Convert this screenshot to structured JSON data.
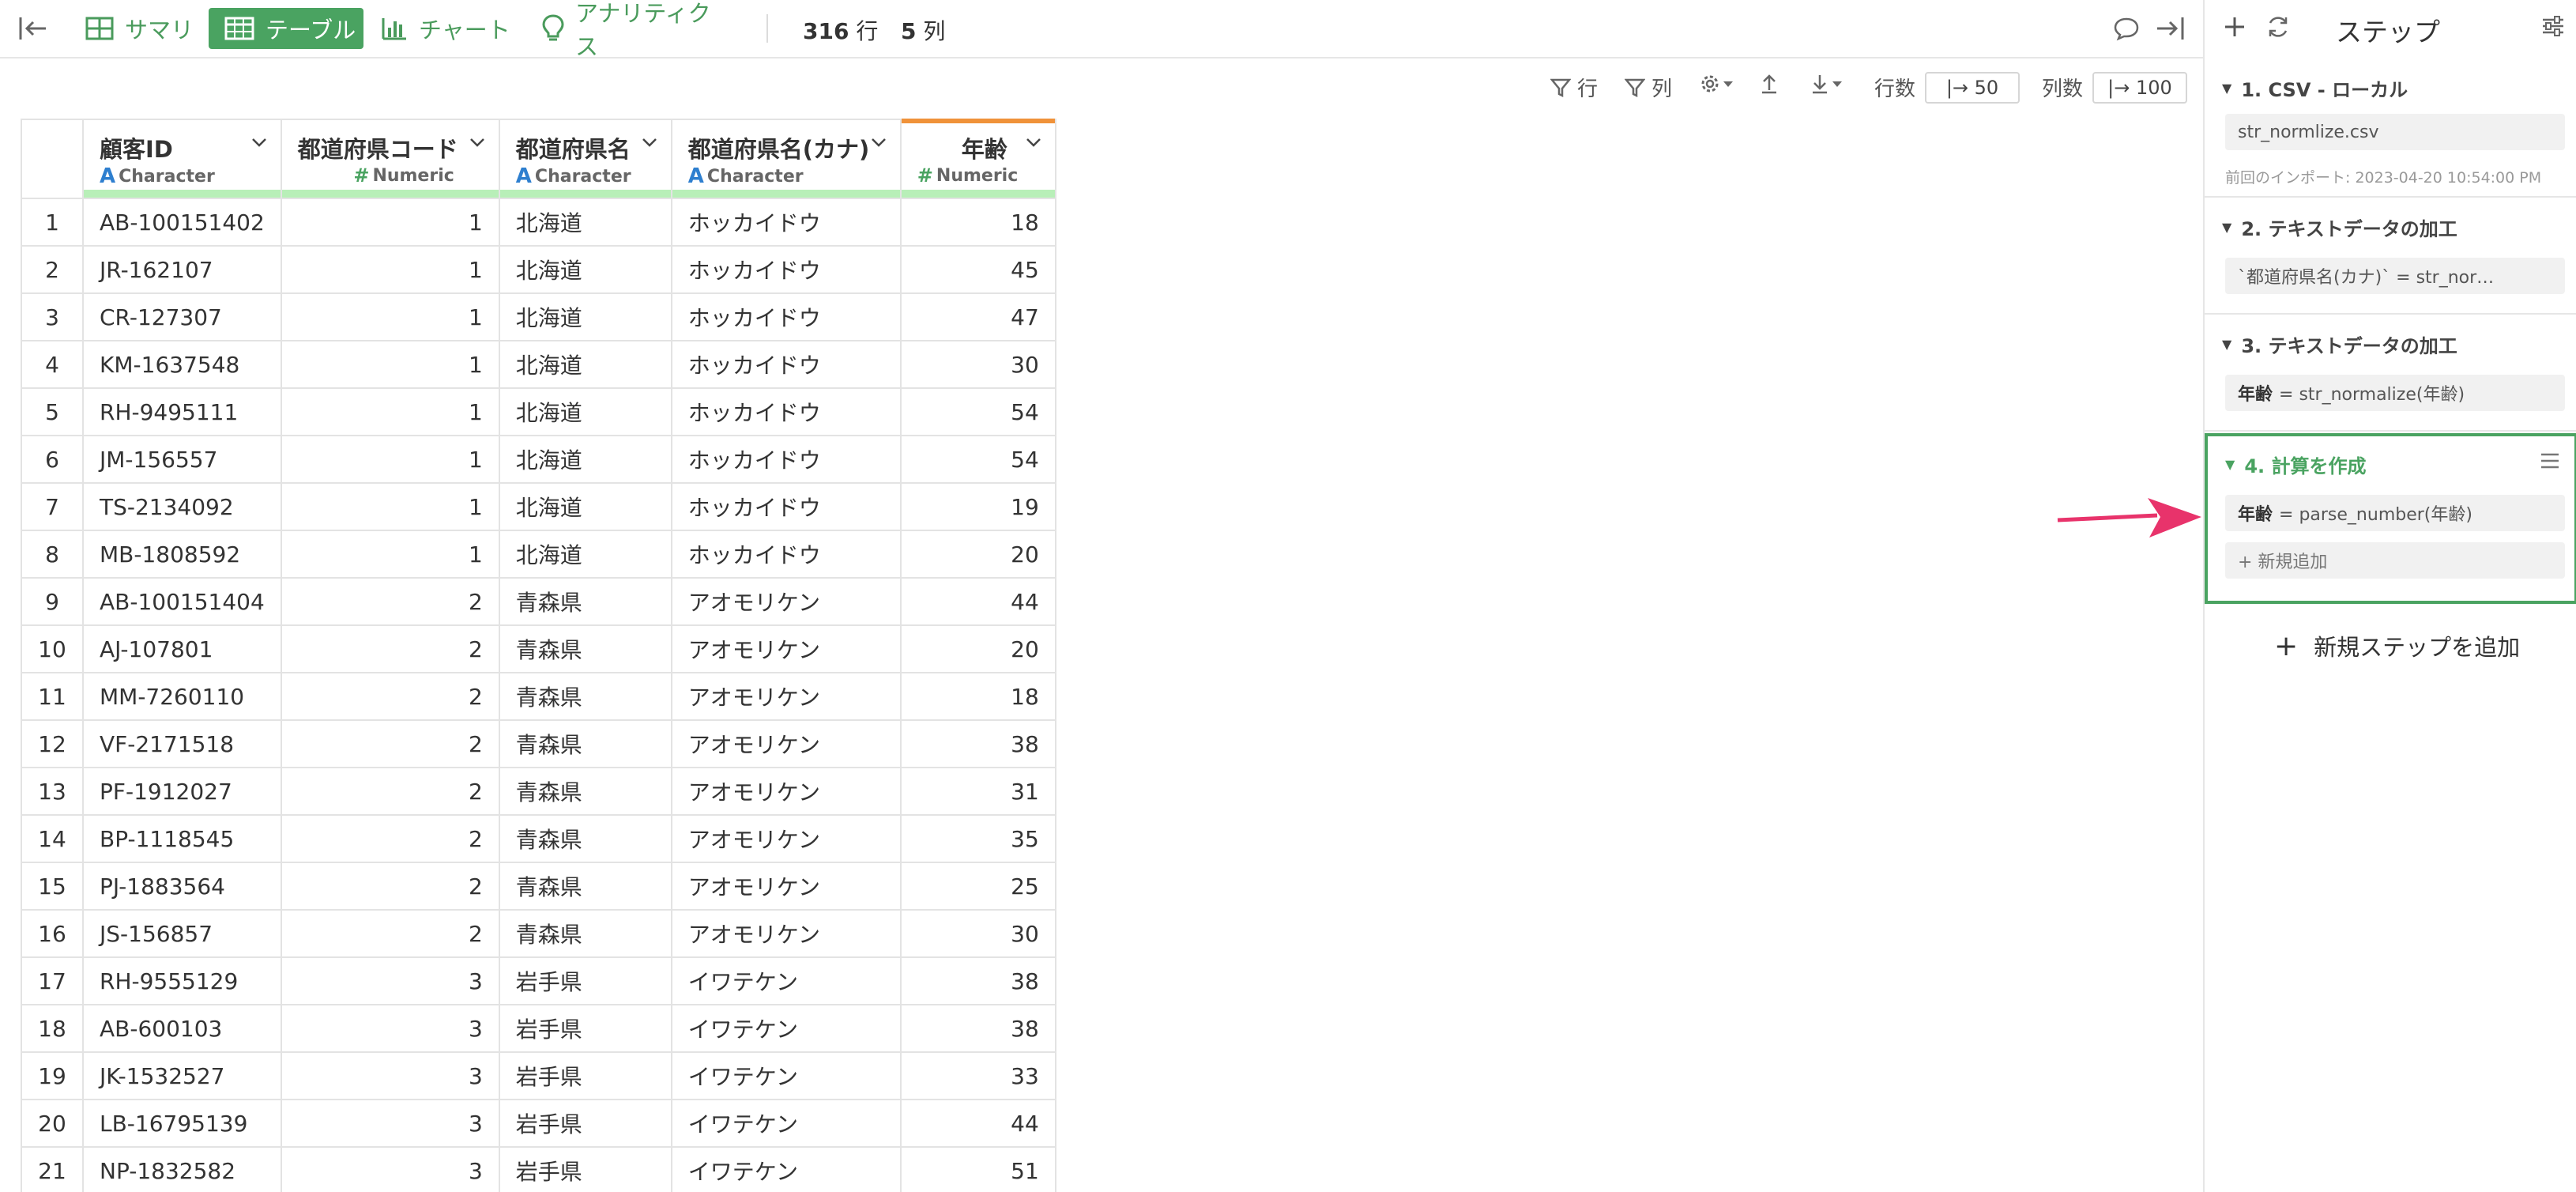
{
  "topbar": {
    "tabs": [
      {
        "label": "サマリ",
        "icon": "summary-grid-icon"
      },
      {
        "label": "テーブル",
        "icon": "table-icon",
        "active": true
      },
      {
        "label": "チャート",
        "icon": "bar-chart-icon"
      },
      {
        "label": "アナリティクス",
        "icon": "lightbulb-icon"
      }
    ],
    "rows_count": "316",
    "rows_unit": "行",
    "cols_count": "5",
    "cols_unit": "列"
  },
  "toolbar": {
    "row_filter_label": "行",
    "col_filter_label": "列",
    "rows_label": "行数",
    "rows_value": "|→ 50",
    "cols_label": "列数",
    "cols_value": "|→ 100"
  },
  "table": {
    "columns": [
      {
        "name": "顧客ID",
        "type": "Character"
      },
      {
        "name": "都道府県コード",
        "type": "Numeric"
      },
      {
        "name": "都道府県名",
        "type": "Character"
      },
      {
        "name": "都道府県名(カナ)",
        "type": "Character"
      },
      {
        "name": "年齢",
        "type": "Numeric"
      }
    ],
    "rows": [
      [
        "1",
        "AB-100151402",
        "1",
        "北海道",
        "ホッカイドウ",
        "18"
      ],
      [
        "2",
        "JR-162107",
        "1",
        "北海道",
        "ホッカイドウ",
        "45"
      ],
      [
        "3",
        "CR-127307",
        "1",
        "北海道",
        "ホッカイドウ",
        "47"
      ],
      [
        "4",
        "KM-1637548",
        "1",
        "北海道",
        "ホッカイドウ",
        "30"
      ],
      [
        "5",
        "RH-9495111",
        "1",
        "北海道",
        "ホッカイドウ",
        "54"
      ],
      [
        "6",
        "JM-156557",
        "1",
        "北海道",
        "ホッカイドウ",
        "54"
      ],
      [
        "7",
        "TS-2134092",
        "1",
        "北海道",
        "ホッカイドウ",
        "19"
      ],
      [
        "8",
        "MB-1808592",
        "1",
        "北海道",
        "ホッカイドウ",
        "20"
      ],
      [
        "9",
        "AB-100151404",
        "2",
        "青森県",
        "アオモリケン",
        "44"
      ],
      [
        "10",
        "AJ-107801",
        "2",
        "青森県",
        "アオモリケン",
        "20"
      ],
      [
        "11",
        "MM-7260110",
        "2",
        "青森県",
        "アオモリケン",
        "18"
      ],
      [
        "12",
        "VF-2171518",
        "2",
        "青森県",
        "アオモリケン",
        "38"
      ],
      [
        "13",
        "PF-1912027",
        "2",
        "青森県",
        "アオモリケン",
        "31"
      ],
      [
        "14",
        "BP-1118545",
        "2",
        "青森県",
        "アオモリケン",
        "35"
      ],
      [
        "15",
        "PJ-1883564",
        "2",
        "青森県",
        "アオモリケン",
        "25"
      ],
      [
        "16",
        "JS-156857",
        "2",
        "青森県",
        "アオモリケン",
        "30"
      ],
      [
        "17",
        "RH-9555129",
        "3",
        "岩手県",
        "イワテケン",
        "38"
      ],
      [
        "18",
        "AB-600103",
        "3",
        "岩手県",
        "イワテケン",
        "38"
      ],
      [
        "19",
        "JK-1532527",
        "3",
        "岩手県",
        "イワテケン",
        "33"
      ],
      [
        "20",
        "LB-16795139",
        "3",
        "岩手県",
        "イワテケン",
        "44"
      ],
      [
        "21",
        "NP-1832582",
        "3",
        "岩手県",
        "イワテケン",
        "51"
      ]
    ]
  },
  "panel": {
    "title": "ステップ",
    "steps": [
      {
        "title": "1. CSV - ローカル",
        "box": "str_normlize.csv",
        "note": "前回のインポート: 2023-04-20 10:54:00 PM"
      },
      {
        "title": "2. テキストデータの加工",
        "box": "`都道府県名(カナ)` = str_nor…"
      },
      {
        "title": "3. テキストデータの加工",
        "box_key": "年齢",
        "box_rest": "= str_normalize(年齢)"
      },
      {
        "title": "4. 計算を作成",
        "box_key": "年齢",
        "box_rest": "= parse_number(年齢)",
        "add_label": "+ 新規追加"
      }
    ],
    "add_step_label": "新規ステップを追加"
  },
  "colors": {
    "accent": "#4aa361",
    "annotation_arrow": "#e8336b",
    "numeric_column_marker": "#f0923a"
  }
}
